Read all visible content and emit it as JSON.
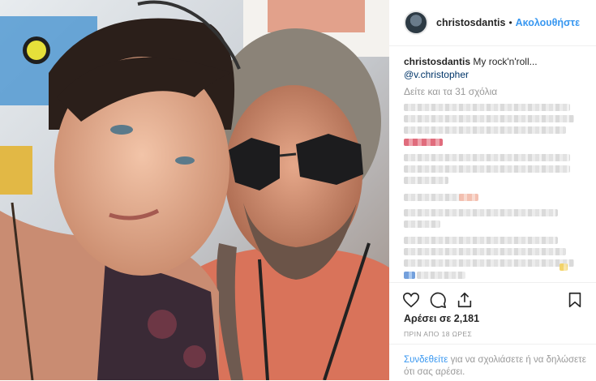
{
  "header": {
    "username": "christosdantis",
    "separator": "•",
    "follow_label": "Ακολουθήστε"
  },
  "caption": {
    "username": "christosdantis",
    "text": "My rock'n'roll...",
    "mention": "@v.christopher"
  },
  "comments": {
    "view_all_label": "Δείτε και τα 31 σχόλια"
  },
  "actions": {
    "icons": [
      "heart-icon",
      "comment-icon",
      "share-icon",
      "bookmark-icon"
    ]
  },
  "likes": {
    "label": "Αρέσει σε 2,181"
  },
  "timestamp": "ΠΡΙΝ ΑΠΟ 18 ΩΡΕΣ",
  "footer": {
    "login_link": "Συνδεθείτε",
    "rest_text": " για να σχολιάσετε ή να δηλώσετε ότι σας αρέσει."
  },
  "colors": {
    "accent": "#3897f0",
    "mention": "#003569",
    "muted": "#999999"
  }
}
